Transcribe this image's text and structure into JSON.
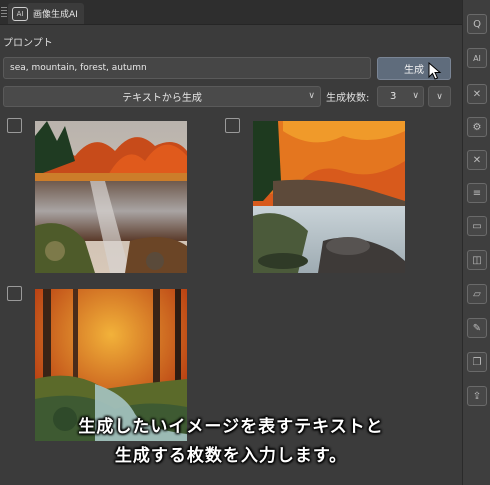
{
  "tab": {
    "badge": "AI",
    "title": "画像生成AI"
  },
  "prompt": {
    "label": "プロンプト",
    "value": "sea, mountain, forest, autumn"
  },
  "generate_button": "生成",
  "mode_select": {
    "value": "テキストから生成"
  },
  "count": {
    "label": "生成枚数:",
    "value": "3"
  },
  "caption": {
    "line1": "生成したいイメージを表すテキストと",
    "line2": "生成する枚数を入力します。"
  },
  "sidebar": {
    "items": [
      {
        "icon": "search-icon",
        "glyph": "Q"
      },
      {
        "icon": "ai-icon",
        "glyph": "AI"
      },
      {
        "icon": "close-icon",
        "glyph": "✕"
      },
      {
        "icon": "gear-icon",
        "glyph": "⚙"
      },
      {
        "icon": "close-icon",
        "glyph": "✕"
      },
      {
        "icon": "list-icon",
        "glyph": "≡"
      },
      {
        "icon": "image-icon",
        "glyph": "▭"
      },
      {
        "icon": "layers-icon",
        "glyph": "◫"
      },
      {
        "icon": "folder-icon",
        "glyph": "▱"
      },
      {
        "icon": "edit-icon",
        "glyph": "✎"
      },
      {
        "icon": "copy-icon",
        "glyph": "❐"
      },
      {
        "icon": "export-icon",
        "glyph": "⇪"
      }
    ]
  }
}
